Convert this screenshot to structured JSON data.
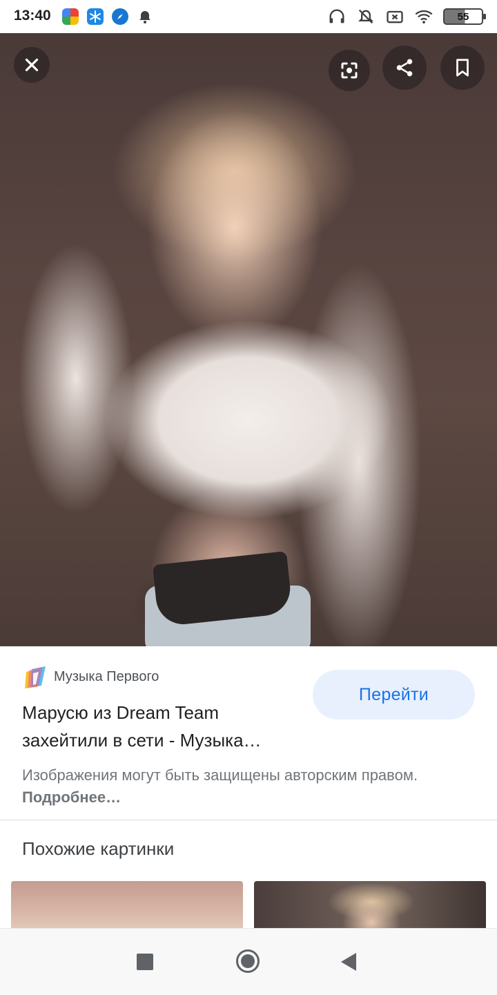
{
  "status_bar": {
    "time": "13:40",
    "battery_level": "55",
    "left_icons": [
      "app-icon-colorful",
      "snowflake-app-icon",
      "compass-app-icon",
      "alarm-icon"
    ],
    "right_icons": [
      "headphones-icon",
      "mute-icon",
      "no-sim-icon",
      "wifi-icon",
      "battery-icon"
    ]
  },
  "viewer": {
    "close_icon": "close-icon",
    "lens_icon": "google-lens-icon",
    "share_icon": "share-icon",
    "bookmark_icon": "bookmark-icon"
  },
  "result": {
    "source_name": "Музыка Первого",
    "go_button_label": "Перейти",
    "title_line1": "Марусю из Dream Team",
    "title_line2": "захейтили в сети - Музыка…",
    "copyright_text": "Изображения могут быть защищены авторским правом.",
    "copyright_link": "Подробнее…"
  },
  "similar": {
    "heading": "Похожие картинки"
  },
  "colors": {
    "accent": "#1a73e8",
    "button_bg": "#e8f0fe",
    "text_primary": "#202124",
    "text_secondary": "#70757a"
  }
}
